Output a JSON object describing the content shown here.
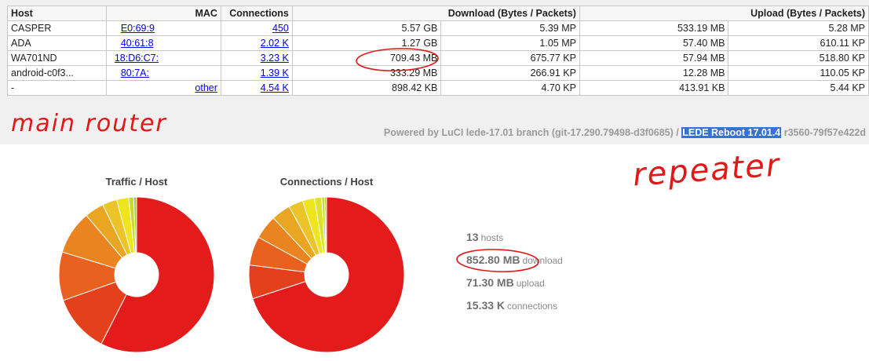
{
  "router_table": {
    "headers": {
      "host": "Host",
      "mac": "MAC",
      "connections": "Connections",
      "download": "Download (Bytes / Packets)",
      "upload": "Upload (Bytes / Packets)"
    },
    "rows": [
      {
        "host": "CASPER",
        "mac": "E0:69:9",
        "connections": "450",
        "dl_bytes": "5.57 GB",
        "dl_packets": "5.39 MP",
        "ul_bytes": "533.19 MB",
        "ul_packets": "5.28 MP"
      },
      {
        "host": "ADA",
        "mac": "40:61:8",
        "connections": "2.02 K",
        "dl_bytes": "1.27 GB",
        "dl_packets": "1.05 MP",
        "ul_bytes": "57.40 MB",
        "ul_packets": "610.11 KP"
      },
      {
        "host": "WA701ND",
        "mac": "18:D6:C7:",
        "connections": "3.23 K",
        "dl_bytes": "709.43 MB",
        "dl_packets": "675.77 KP",
        "ul_bytes": "57.94 MB",
        "ul_packets": "518.80 KP"
      },
      {
        "host": "android-c0f3...",
        "mac": "80:7A:",
        "connections": "1.39 K",
        "dl_bytes": "333.29 MB",
        "dl_packets": "266.91 KP",
        "ul_bytes": "12.28 MB",
        "ul_packets": "110.05 KP"
      },
      {
        "host": "-",
        "mac": "other",
        "connections": "4.54 K",
        "dl_bytes": "898.42 KB",
        "dl_packets": "4.70 KP",
        "ul_bytes": "413.91 KB",
        "ul_packets": "5.44 KP"
      }
    ]
  },
  "footer": {
    "prefix": "Powered by LuCI lede-17.01 branch (git-17.290.79498-d3f0685) / ",
    "version": "LEDE Reboot 17.01.4",
    "suffix": " r3560-79f57e422d"
  },
  "annotations": {
    "main_router": "main router",
    "repeater": "repeater",
    "color": "#e01818"
  },
  "chart_data": [
    {
      "type": "pie",
      "title": "Traffic / Host",
      "values": [
        57,
        12,
        10,
        9,
        4,
        3,
        2.5,
        1,
        0.6
      ],
      "colors": [
        "#e41b1b",
        "#e5401c",
        "#e8611e",
        "#ea8420",
        "#e9a622",
        "#ecc42a",
        "#eee51c",
        "#c5da2e",
        "#a8c83a"
      ]
    },
    {
      "type": "pie",
      "title": "Connections / Host",
      "values": [
        70,
        7,
        6,
        5,
        4,
        3,
        2.5,
        1.5,
        0.6,
        0.4
      ],
      "colors": [
        "#e41b1b",
        "#e5401c",
        "#e8611e",
        "#ea8420",
        "#e9a622",
        "#ecc42a",
        "#eee51c",
        "#dbe427",
        "#c5da2e",
        "#a8c83a"
      ]
    }
  ],
  "summary": [
    {
      "value": "13",
      "unit": "hosts"
    },
    {
      "value": "852.80 MB",
      "unit": "download"
    },
    {
      "value": "71.30 MB",
      "unit": "upload"
    },
    {
      "value": "15.33 K",
      "unit": "connections"
    }
  ]
}
